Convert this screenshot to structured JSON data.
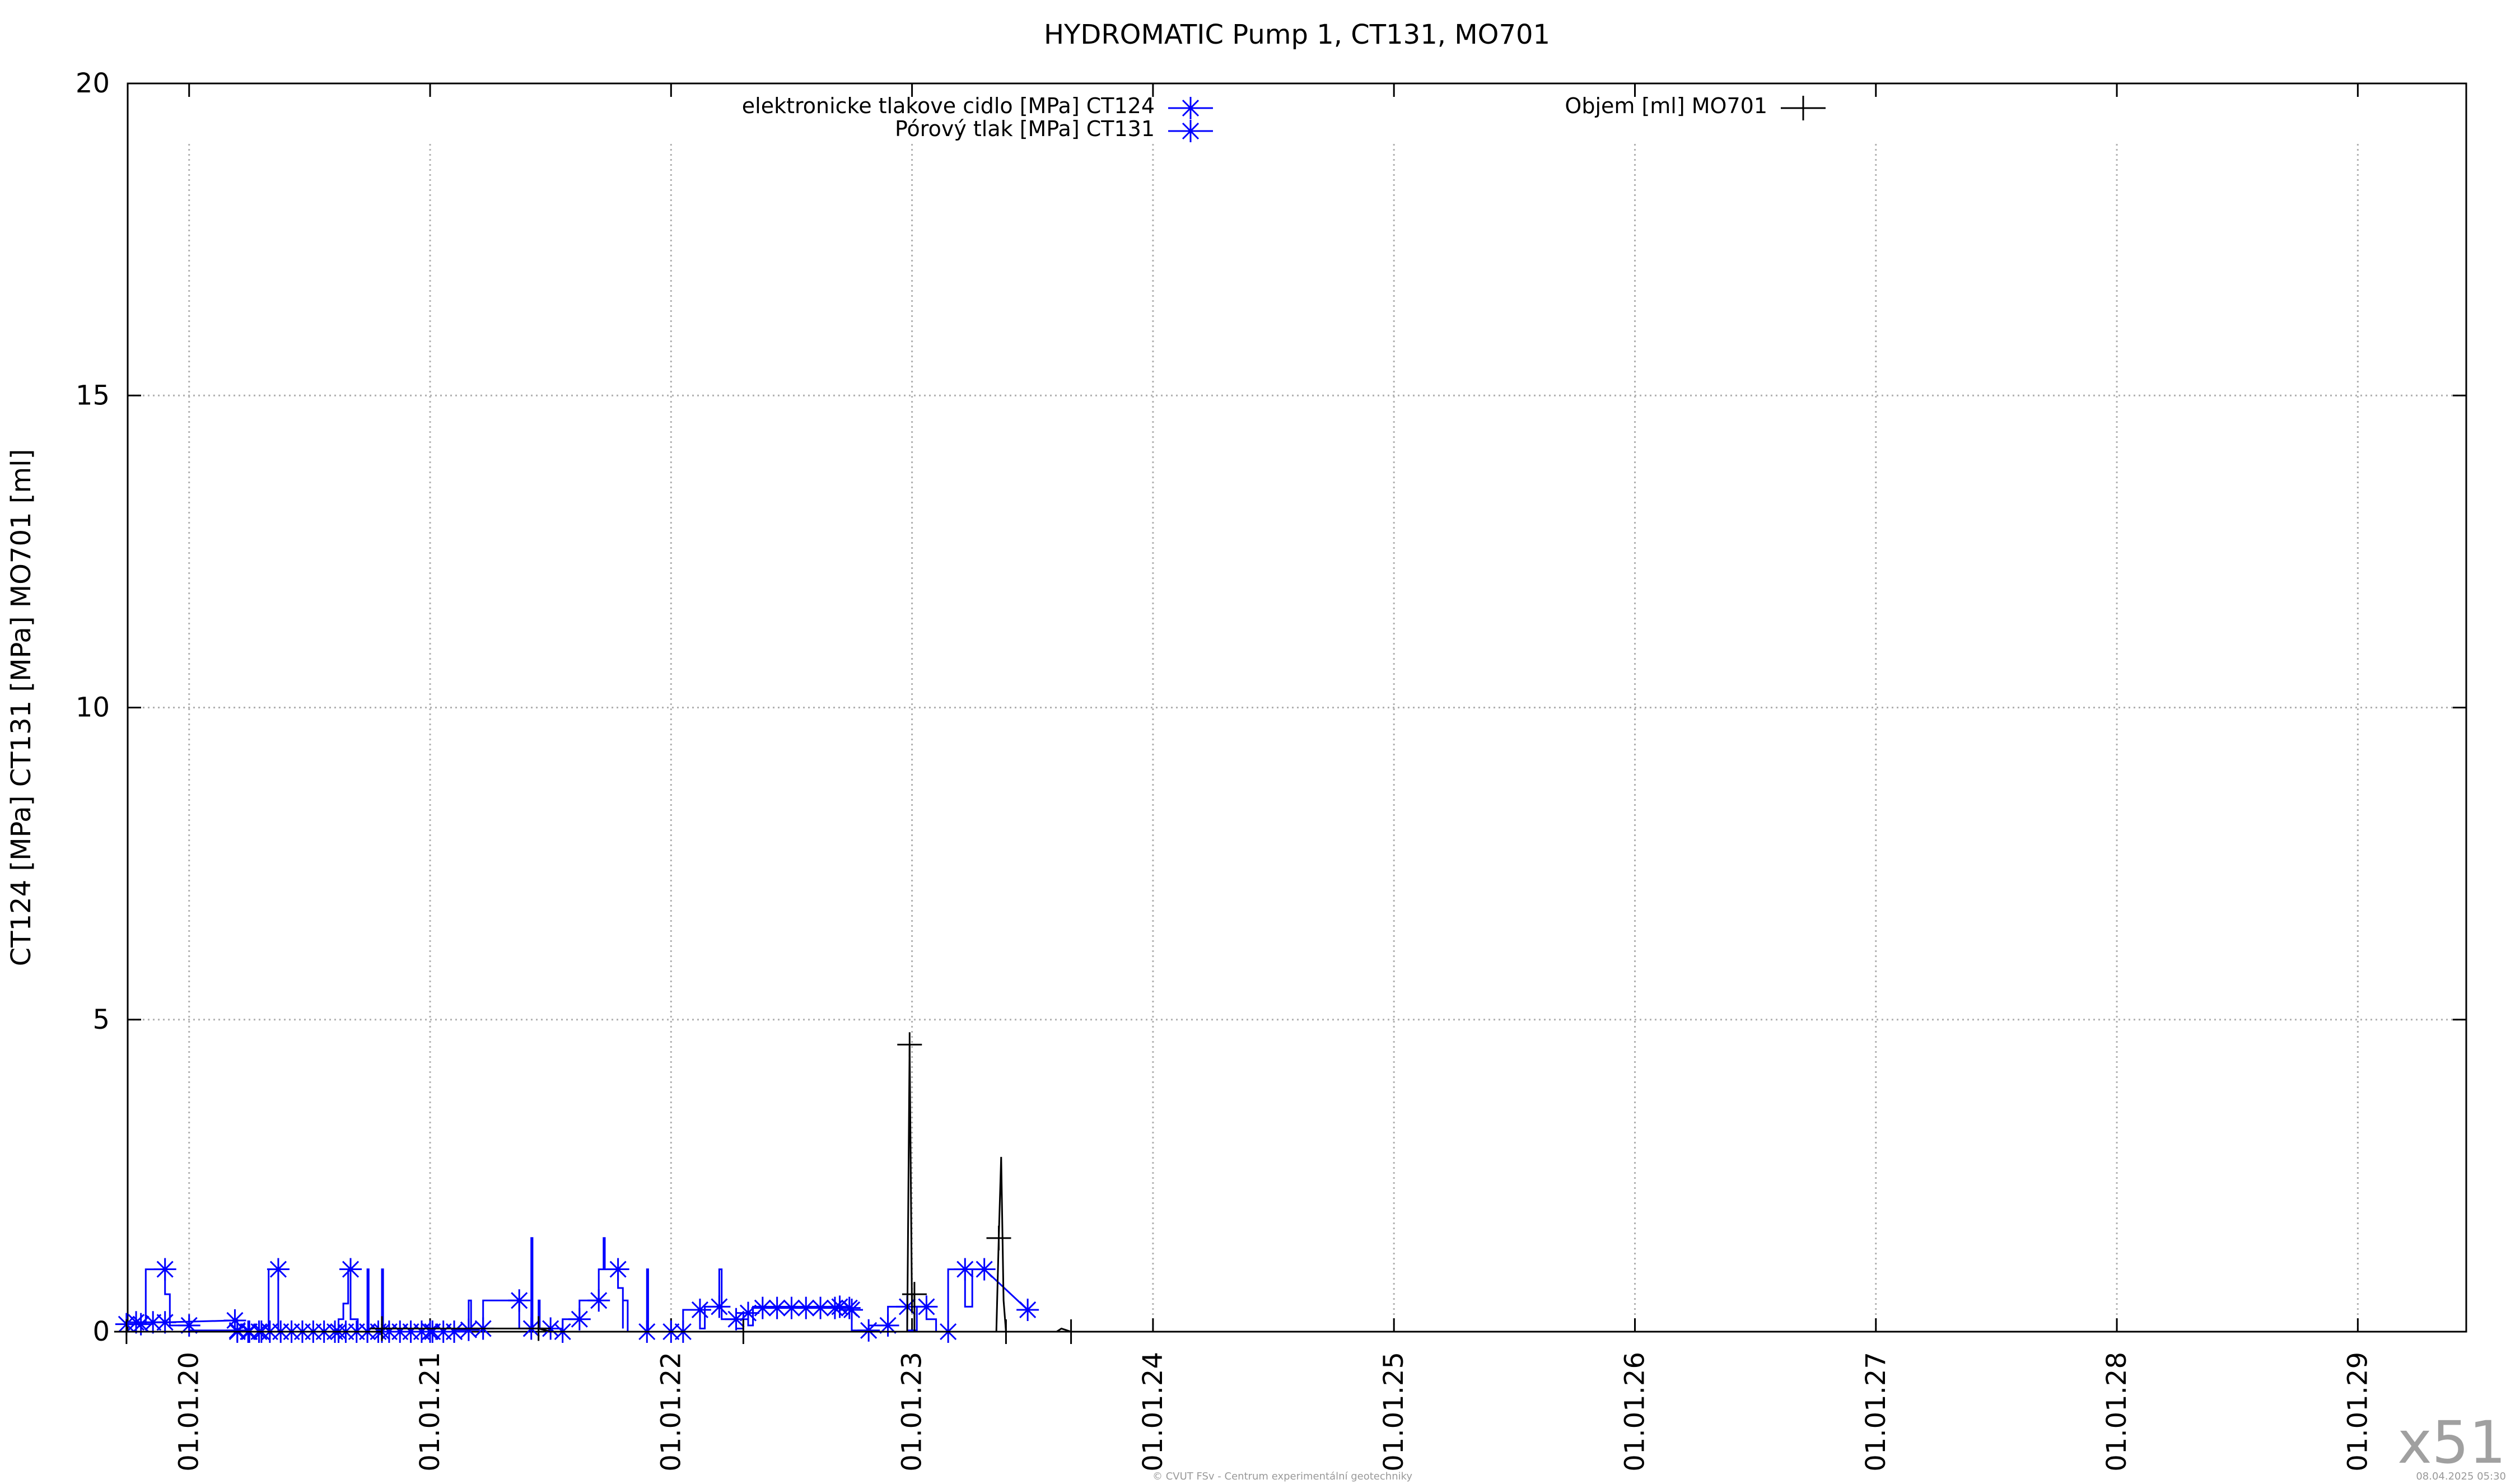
{
  "chart_data": {
    "type": "line",
    "title": "HYDROMATIC Pump 1, CT131, MO701",
    "ylabel": "CT124 [MPa] CT131 [MPa] MO701 [ml]",
    "xlabel": "",
    "ylim": [
      0,
      20
    ],
    "xlim": [
      19.745,
      29.45
    ],
    "yticks": [
      0,
      5,
      10,
      15,
      20
    ],
    "xticks": [
      {
        "value": 20,
        "label": "01.01.20"
      },
      {
        "value": 21,
        "label": "01.01.21"
      },
      {
        "value": 22,
        "label": "01.01.22"
      },
      {
        "value": 23,
        "label": "01.01.23"
      },
      {
        "value": 24,
        "label": "01.01.24"
      },
      {
        "value": 25,
        "label": "01.01.25"
      },
      {
        "value": 26,
        "label": "01.01.26"
      },
      {
        "value": 27,
        "label": "01.01.27"
      },
      {
        "value": 28,
        "label": "01.01.28"
      },
      {
        "value": 29,
        "label": "01.01.29"
      }
    ],
    "grid": true,
    "series": [
      {
        "name": "elektronicke tlakove cidlo [MPa] CT124",
        "color": "#0000ff",
        "marker": "star",
        "points": [
          [
            19.78,
            0.15
          ],
          [
            19.85,
            0.15
          ],
          [
            19.9,
            0.15
          ],
          [
            20.19,
            0.18
          ]
        ]
      },
      {
        "name": "Pórový tlak [MPa] CT131",
        "color": "#0000ff",
        "marker": "star",
        "points": [
          [
            19.74,
            0.12
          ],
          [
            19.76,
            0.12
          ],
          [
            19.8,
            0.12
          ],
          [
            19.82,
            0.12
          ],
          [
            19.82,
            1.0
          ],
          [
            19.9,
            1.0
          ],
          [
            19.9,
            0.6
          ],
          [
            19.92,
            0.6
          ],
          [
            19.92,
            0.1
          ],
          [
            20.0,
            0.1
          ],
          [
            20.0,
            0.02
          ],
          [
            20.2,
            0.02
          ],
          [
            20.25,
            0.0
          ],
          [
            20.3,
            0.0
          ],
          [
            20.33,
            0.0
          ],
          [
            20.33,
            1.0
          ],
          [
            20.37,
            1.0
          ],
          [
            20.37,
            0.0
          ],
          [
            20.62,
            0.0
          ],
          [
            20.62,
            0.2
          ],
          [
            20.64,
            0.2
          ],
          [
            20.64,
            0.45
          ],
          [
            20.66,
            0.45
          ],
          [
            20.66,
            1.0
          ],
          [
            20.67,
            1.0
          ],
          [
            20.67,
            0.2
          ],
          [
            20.7,
            0.2
          ],
          [
            20.7,
            0.0
          ],
          [
            20.74,
            0.0
          ],
          [
            20.74,
            1.0
          ],
          [
            20.745,
            1.0
          ],
          [
            20.745,
            0.0
          ],
          [
            20.8,
            0.0
          ],
          [
            20.8,
            1.0
          ],
          [
            20.805,
            1.0
          ],
          [
            20.805,
            0.0
          ],
          [
            21.0,
            0.0
          ],
          [
            21.1,
            0.0
          ],
          [
            21.1,
            0.03
          ],
          [
            21.16,
            0.03
          ],
          [
            21.16,
            0.5
          ],
          [
            21.17,
            0.5
          ],
          [
            21.17,
            0.05
          ],
          [
            21.22,
            0.05
          ],
          [
            21.22,
            0.5
          ],
          [
            21.37,
            0.5
          ],
          [
            21.37,
            0.05
          ],
          [
            21.42,
            0.05
          ],
          [
            21.42,
            1.5
          ],
          [
            21.425,
            1.5
          ],
          [
            21.425,
            0.05
          ],
          [
            21.45,
            0.05
          ],
          [
            21.45,
            0.5
          ],
          [
            21.455,
            0.5
          ],
          [
            21.455,
            0.05
          ],
          [
            21.5,
            0.05
          ],
          [
            21.5,
            0.0
          ],
          [
            21.55,
            0.0
          ],
          [
            21.55,
            0.2
          ],
          [
            21.62,
            0.2
          ],
          [
            21.62,
            0.5
          ],
          [
            21.7,
            0.5
          ],
          [
            21.7,
            1.0
          ],
          [
            21.72,
            1.0
          ],
          [
            21.72,
            1.5
          ],
          [
            21.725,
            1.5
          ],
          [
            21.725,
            1.0
          ],
          [
            21.78,
            1.0
          ],
          [
            21.78,
            0.7
          ],
          [
            21.8,
            0.7
          ],
          [
            21.8,
            0.05
          ],
          [
            21.8,
            0.5
          ],
          [
            21.82,
            0.5
          ],
          [
            21.82,
            0.0
          ],
          [
            21.9,
            0.0
          ],
          [
            21.9,
            1.0
          ],
          [
            21.905,
            1.0
          ],
          [
            21.905,
            0.0
          ],
          [
            22.0,
            0.0
          ],
          [
            22.05,
            0.0
          ],
          [
            22.05,
            0.35
          ],
          [
            22.12,
            0.35
          ],
          [
            22.12,
            0.05
          ],
          [
            22.14,
            0.05
          ],
          [
            22.14,
            0.4
          ],
          [
            22.2,
            0.4
          ],
          [
            22.2,
            1.0
          ],
          [
            22.21,
            1.0
          ],
          [
            22.21,
            0.2
          ],
          [
            22.27,
            0.2
          ],
          [
            22.27,
            0.05
          ],
          [
            22.3,
            0.05
          ],
          [
            22.3,
            0.3
          ],
          [
            22.32,
            0.3
          ],
          [
            22.32,
            0.1
          ],
          [
            22.34,
            0.1
          ],
          [
            22.34,
            0.4
          ],
          [
            22.7,
            0.4
          ],
          [
            22.7,
            0.35
          ],
          [
            22.75,
            0.35
          ],
          [
            22.75,
            0.02
          ],
          [
            22.82,
            0.02
          ],
          [
            22.82,
            0.1
          ],
          [
            22.9,
            0.1
          ],
          [
            22.9,
            0.4
          ],
          [
            22.98,
            0.4
          ],
          [
            22.98,
            0.02
          ],
          [
            23.02,
            0.02
          ],
          [
            23.02,
            0.4
          ],
          [
            23.06,
            0.4
          ],
          [
            23.06,
            0.2
          ],
          [
            23.1,
            0.2
          ],
          [
            23.1,
            0.0
          ],
          [
            23.15,
            0.0
          ],
          [
            23.15,
            0.5
          ],
          [
            23.15,
            1.0
          ],
          [
            23.22,
            1.0
          ],
          [
            23.22,
            0.4
          ],
          [
            23.25,
            0.4
          ],
          [
            23.25,
            1.0
          ],
          [
            23.3,
            1.0
          ],
          [
            23.48,
            0.35
          ]
        ]
      },
      {
        "name": "Objem [ml] MO701",
        "color": "#000000",
        "marker": "plus",
        "points": [
          [
            19.74,
            0.0
          ],
          [
            20.2,
            0.0
          ],
          [
            20.8,
            0.0
          ],
          [
            20.8,
            0.05
          ],
          [
            21.2,
            0.05
          ],
          [
            21.4,
            0.05
          ],
          [
            21.45,
            0.05
          ],
          [
            21.5,
            0.0
          ],
          [
            21.8,
            0.0
          ],
          [
            22.3,
            0.0
          ],
          [
            22.9,
            0.0
          ],
          [
            22.98,
            0.0
          ],
          [
            22.99,
            4.6
          ],
          [
            23.0,
            0.3
          ],
          [
            23.0,
            0.6
          ],
          [
            23.01,
            0.6
          ],
          [
            23.01,
            0.0
          ],
          [
            23.35,
            0.0
          ],
          [
            23.36,
            1.5
          ],
          [
            23.37,
            2.8
          ],
          [
            23.38,
            0.5
          ],
          [
            23.39,
            0.0
          ],
          [
            23.6,
            0.0
          ],
          [
            23.62,
            0.05
          ],
          [
            23.66,
            0.0
          ]
        ]
      }
    ],
    "legend": {
      "placement": "top",
      "entries": [
        "elektronicke tlakove cidlo [MPa] CT124",
        "Pórový tlak [MPa] CT131",
        "Objem [ml] MO701"
      ]
    }
  },
  "footer": {
    "copyright": "© CVUT FSv - Centrum experimentální geotechniky",
    "timestamp": "08.04.2025 05:30",
    "badge": "x51"
  }
}
